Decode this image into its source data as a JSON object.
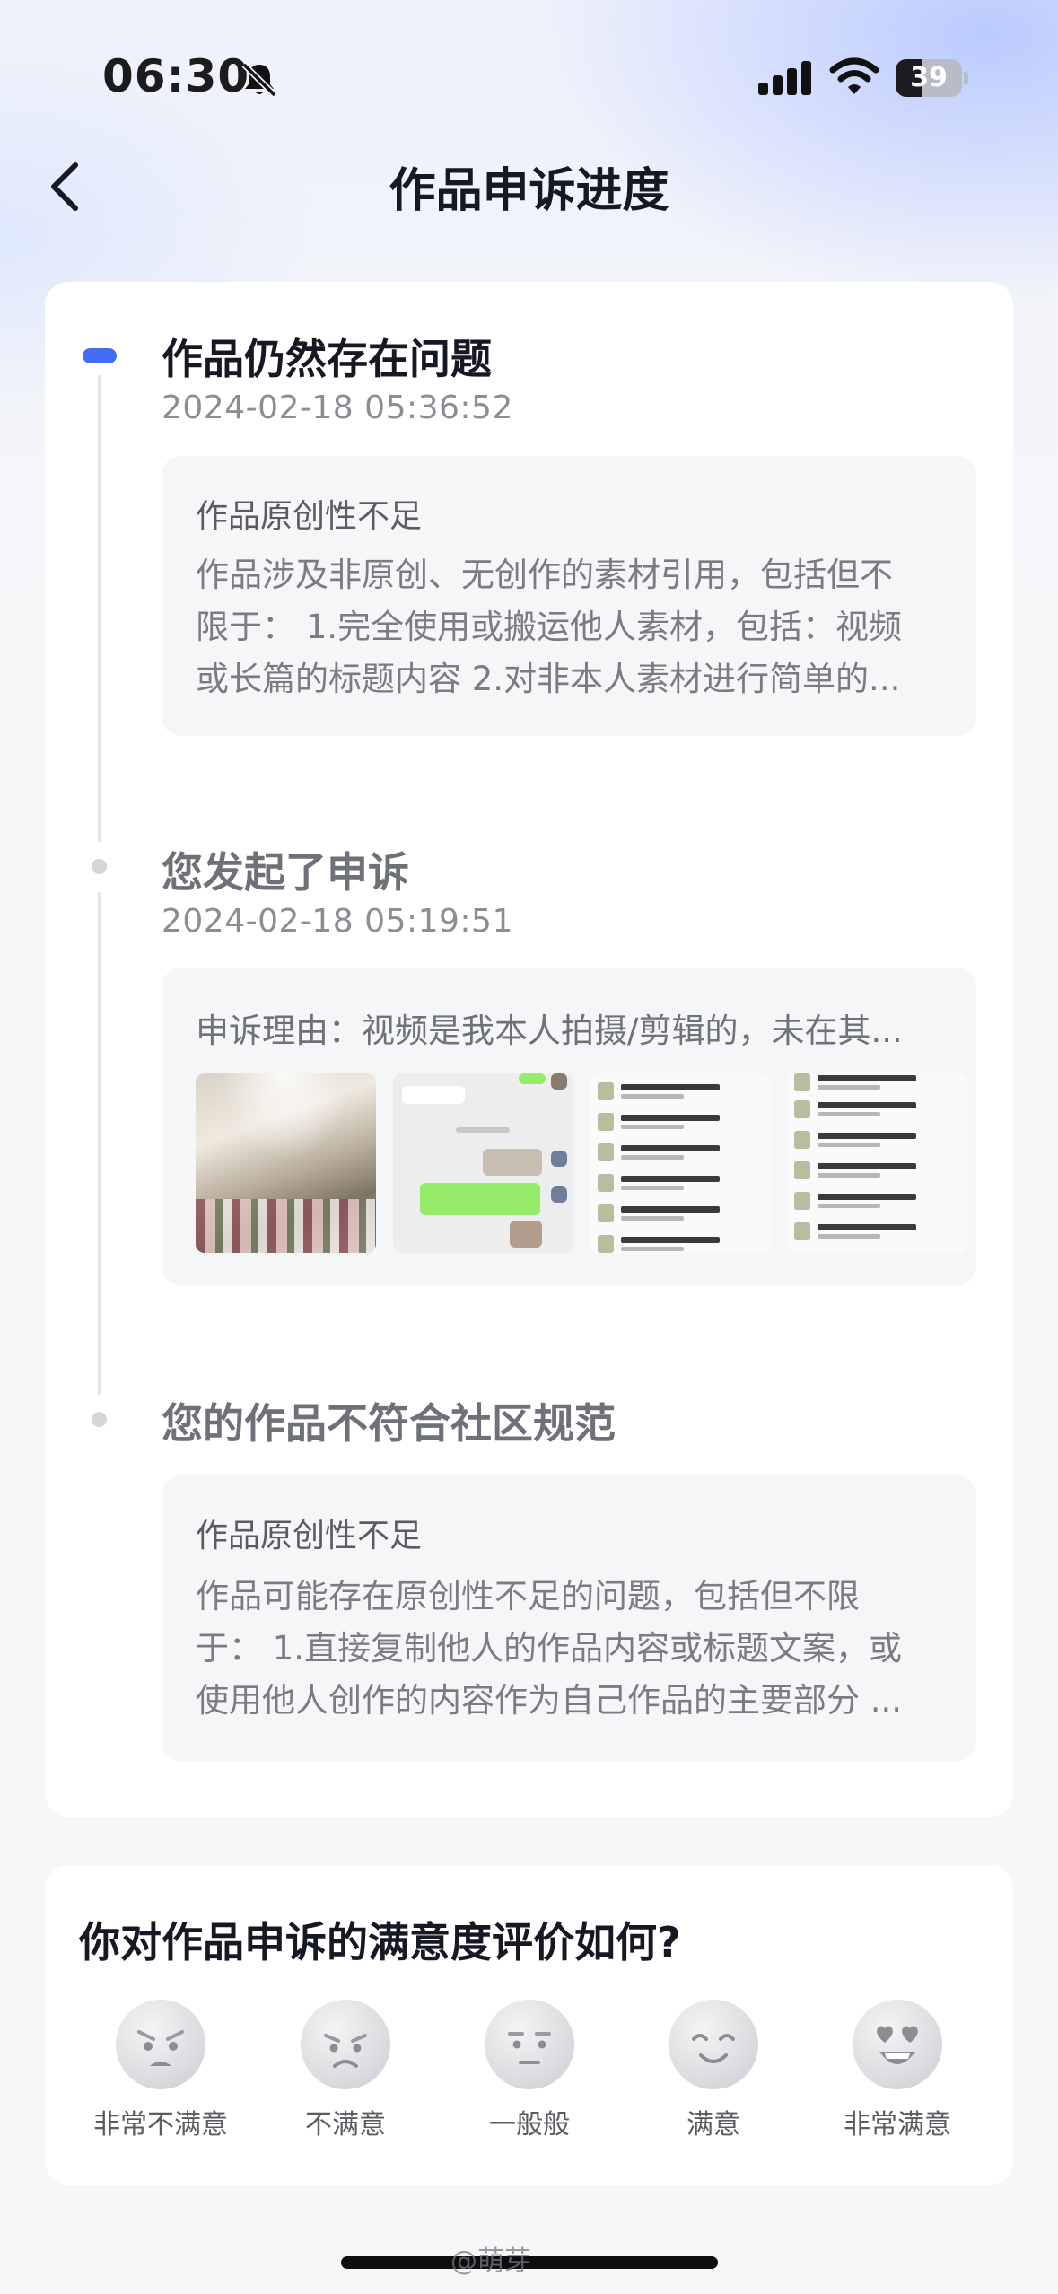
{
  "status_bar": {
    "time": "06:30",
    "battery": "39",
    "battery_level": 0.39
  },
  "nav": {
    "title": "作品申诉进度"
  },
  "timeline": [
    {
      "title": "作品仍然存在问题",
      "time": "2024-02-18 05:36:52",
      "box_heading": "作品原创性不足",
      "box_lines": [
        "作品涉及非原创、无创作的素材引用，包括但不",
        "限于： 1.完全使用或搬运他人素材，包括：视频",
        "或长篇的标题内容 2.对非本人素材进行简单的..."
      ]
    },
    {
      "title": "您发起了申诉",
      "time": "2024-02-18 05:19:51",
      "box_heading": "申诉理由：视频是我本人拍摄/剪辑的，未在其...",
      "thumbnails": [
        "photo-thumbnail",
        "chat-screenshot-thumbnail",
        "file-list-screenshot-thumbnail",
        "file-list-screenshot-thumbnail"
      ]
    },
    {
      "title": "您的作品不符合社区规范",
      "time": "",
      "box_heading": "作品原创性不足",
      "box_lines": [
        "作品可能存在原创性不足的问题，包括但不限",
        "于： 1.直接复制他人的作品内容或标题文案，或",
        "使用他人创作的内容作为自己作品的主要部分 ..."
      ]
    }
  ],
  "rating": {
    "title": "你对作品申诉的满意度评价如何?",
    "options": [
      {
        "label": "非常不满意",
        "icon": "very-dissatisfied-face-icon"
      },
      {
        "label": "不满意",
        "icon": "dissatisfied-face-icon"
      },
      {
        "label": "一般般",
        "icon": "neutral-face-icon"
      },
      {
        "label": "满意",
        "icon": "satisfied-face-icon"
      },
      {
        "label": "非常满意",
        "icon": "very-satisfied-face-icon"
      }
    ]
  },
  "watermark": "@萌芽",
  "colors": {
    "accent": "#3f6df6",
    "background": "#f6f7f9",
    "card": "#ffffff"
  }
}
